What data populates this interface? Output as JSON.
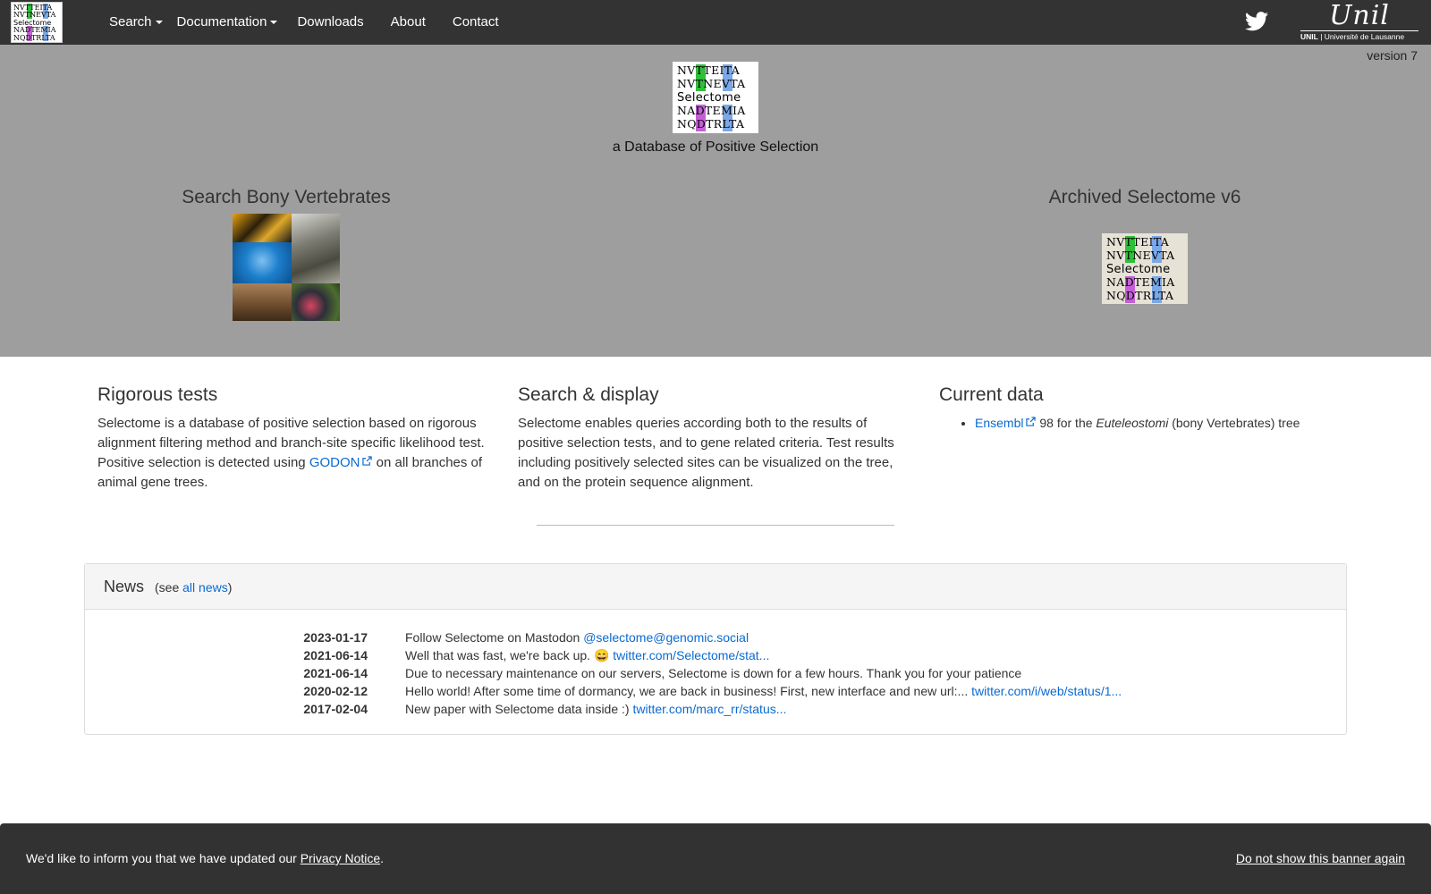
{
  "navbar": {
    "logo_rows": [
      "NVTTEITA",
      "NVTNEVTA",
      "Selectome",
      "NADTEMIA",
      "NQDTRLTA"
    ],
    "items": [
      {
        "label": "Search",
        "dropdown": true
      },
      {
        "label": "Documentation",
        "dropdown": true
      },
      {
        "label": "Downloads",
        "dropdown": false
      },
      {
        "label": "About",
        "dropdown": false
      },
      {
        "label": "Contact",
        "dropdown": false
      }
    ],
    "twitter_icon": "twitter-icon",
    "unil_logo": {
      "script": "Unil",
      "sub_bold": "UNIL",
      "sub": " | Université de Lausanne"
    }
  },
  "hero": {
    "version": "version 7",
    "logo_rows": [
      "NVTTEITA",
      "NVTNEVTA",
      "Selectome",
      "NADTEMIA",
      "NQDTRLTA"
    ],
    "tagline": "a Database of Positive Selection",
    "bony_title": "Search Bony Vertebrates",
    "archive_title": "Archived Selectome v6"
  },
  "features": {
    "rigorous": {
      "title": "Rigorous tests",
      "text_before": "Selectome is a database of positive selection based on rigorous alignment filtering method and branch-site specific likelihood test. Positive selection is detected using ",
      "link": "GODON",
      "text_after": " on all branches of animal gene trees."
    },
    "search": {
      "title": "Search & display",
      "text": "Selectome enables queries according both to the results of positive selection tests, and to gene related criteria. Test results including positively selected sites can be visualized on the tree, and on the protein sequence alignment."
    },
    "current": {
      "title": "Current data",
      "link": "Ensembl",
      "text_mid": " 98 for the ",
      "taxon": "Euteleostomi",
      "text_end": " (bony Vertebrates) tree"
    }
  },
  "news": {
    "title": "News",
    "see_prefix": "(see ",
    "see_link": "all news",
    "see_suffix": ")",
    "items": [
      {
        "date": "2023-01-17",
        "text": "Follow Selectome on Mastodon ",
        "link": "@selectome@genomic.social"
      },
      {
        "date": "2021-06-14",
        "text": "Well that was fast, we're back up. 😄 ",
        "link": "twitter.com/Selectome/stat..."
      },
      {
        "date": "2021-06-14",
        "text": "Due to necessary maintenance on our servers, Selectome is down for a few hours. Thank you for your patience",
        "link": ""
      },
      {
        "date": "2020-02-12",
        "text": "Hello world! After some time of dormancy, we are back in business! First, new interface and new url:... ",
        "link": "twitter.com/i/web/status/1..."
      },
      {
        "date": "2017-02-04",
        "text": "New paper with Selectome data inside :) ",
        "link": "twitter.com/marc_rr/status..."
      }
    ]
  },
  "cookie_banner": {
    "text": "We'd like to inform you that we have updated our ",
    "link": "Privacy Notice",
    "suffix": ".",
    "dismiss": "Do not show this banner again"
  },
  "colors": {
    "navbar_bg": "#333333",
    "hero_bg": "#9e9e9e",
    "link": "#0a6ad1",
    "banner_bg": "#323232",
    "logo_green": "#2fbf3a",
    "logo_blue": "#7aa8e8",
    "logo_purple": "#c45ed6"
  }
}
